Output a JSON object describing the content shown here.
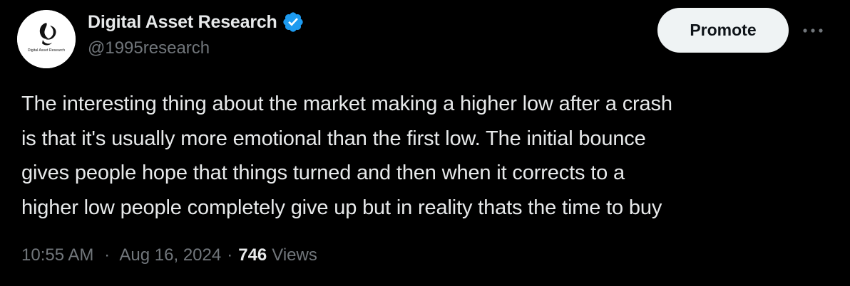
{
  "author": {
    "display_name": "Digital Asset Research",
    "handle": "@1995research",
    "verified": true,
    "avatar_icon": "digital-asset-research-logo",
    "avatar_logo_text": "Digital Asset Research"
  },
  "actions": {
    "promote_label": "Promote",
    "more_icon": "more-options-icon"
  },
  "tweet": {
    "lines": [
      "The interesting thing about the market making a higher low after a crash",
      "is that it's usually more emotional than the first low. The initial bounce",
      "gives people hope that things turned and then when it corrects to a",
      "higher low people completely give up but in reality thats the time to buy"
    ]
  },
  "meta": {
    "time": "10:55 AM",
    "date": "Aug 16, 2024",
    "separator": "·",
    "views_count": "746",
    "views_label": "Views"
  },
  "colors": {
    "background": "#000000",
    "text_primary": "#e7e9ea",
    "text_secondary": "#71767b",
    "verified_blue": "#1d9bf0",
    "promote_bg": "#eff3f4"
  }
}
